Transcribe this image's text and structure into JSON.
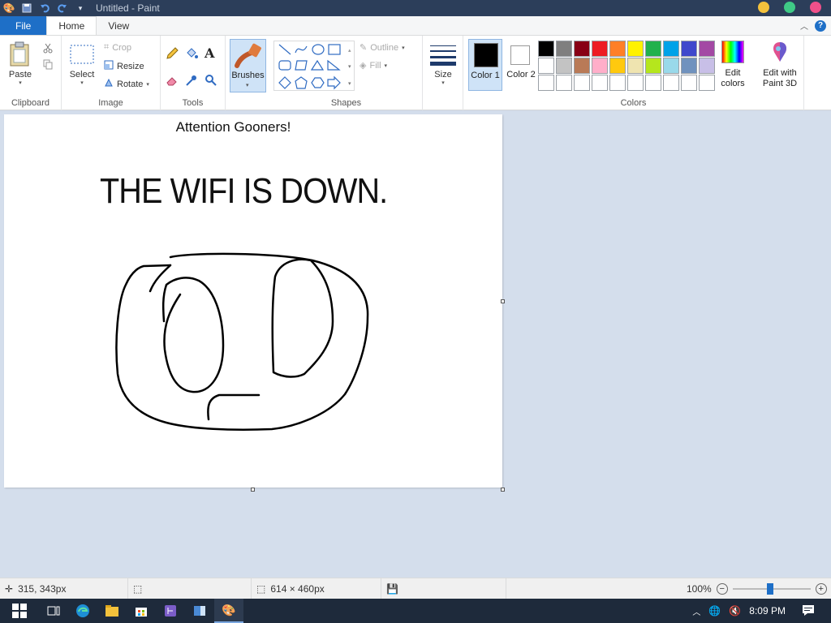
{
  "window": {
    "title": "Untitled - Paint"
  },
  "tabs": {
    "file": "File",
    "home": "Home",
    "view": "View"
  },
  "clipboard": {
    "label": "Clipboard",
    "paste": "Paste"
  },
  "image": {
    "label": "Image",
    "select": "Select",
    "crop": "Crop",
    "resize": "Resize",
    "rotate": "Rotate"
  },
  "tools": {
    "label": "Tools"
  },
  "brushes": {
    "label": "Brushes"
  },
  "shapes": {
    "label": "Shapes",
    "outline": "Outline",
    "fill": "Fill"
  },
  "size": {
    "label": "Size"
  },
  "colors": {
    "label": "Colors",
    "color1": "Color 1",
    "color2": "Color 2",
    "edit_colors": "Edit colors",
    "edit_paint3d": "Edit with Paint 3D",
    "palette_row1": [
      "#000000",
      "#7f7f7f",
      "#880015",
      "#ed1c24",
      "#ff7f27",
      "#fff200",
      "#22b14c",
      "#00a2e8",
      "#3f48cc",
      "#a349a4"
    ],
    "palette_row2": [
      "#ffffff",
      "#c3c3c3",
      "#b97a57",
      "#ffaec9",
      "#ffc90e",
      "#efe4b0",
      "#b5e61d",
      "#99d9ea",
      "#7092be",
      "#c8bfe7"
    ],
    "palette_row3": [
      "#ffffff",
      "#ffffff",
      "#ffffff",
      "#ffffff",
      "#ffffff",
      "#ffffff",
      "#ffffff",
      "#ffffff",
      "#ffffff",
      "#ffffff"
    ],
    "color1_value": "#000000",
    "color2_value": "#ffffff"
  },
  "canvas": {
    "line1": "Attention Gooners!",
    "line2": "THE WIFI IS DOWN."
  },
  "status": {
    "cursor_pos": "315, 343px",
    "canvas_size": "614 × 460px",
    "zoom": "100%"
  },
  "taskbar": {
    "time": "8:09 PM"
  }
}
